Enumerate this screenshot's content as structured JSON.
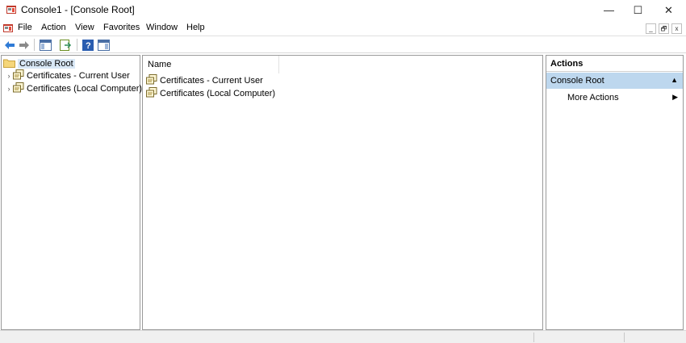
{
  "window": {
    "title": "Console1 - [Console Root]",
    "minimize": "—",
    "maximize": "☐",
    "close": "✕"
  },
  "menu": {
    "items": [
      "File",
      "Action",
      "View",
      "Favorites",
      "Window",
      "Help"
    ],
    "mdi": {
      "minimize": "_",
      "restore": "🗗",
      "close": "x"
    }
  },
  "toolbar": {
    "icons": [
      "back-arrow-icon",
      "forward-arrow-icon",
      "show-hide-tree-icon",
      "export-list-icon",
      "help-icon",
      "show-hide-action-pane-icon"
    ]
  },
  "tree": {
    "root": "Console Root",
    "children": [
      {
        "label": "Certificates - Current User",
        "expander": "›"
      },
      {
        "label": "Certificates (Local Computer)",
        "expander": "›"
      }
    ]
  },
  "list": {
    "column": "Name",
    "rows": [
      "Certificates - Current User",
      "Certificates (Local Computer)"
    ]
  },
  "actions": {
    "title": "Actions",
    "section": "Console Root",
    "section_caret": "▲",
    "item": "More Actions",
    "item_arrow": "▶"
  },
  "colors": {
    "selection": "#d9e8f6",
    "actions_header": "#bdd7ee",
    "accent": "#0078d7"
  }
}
